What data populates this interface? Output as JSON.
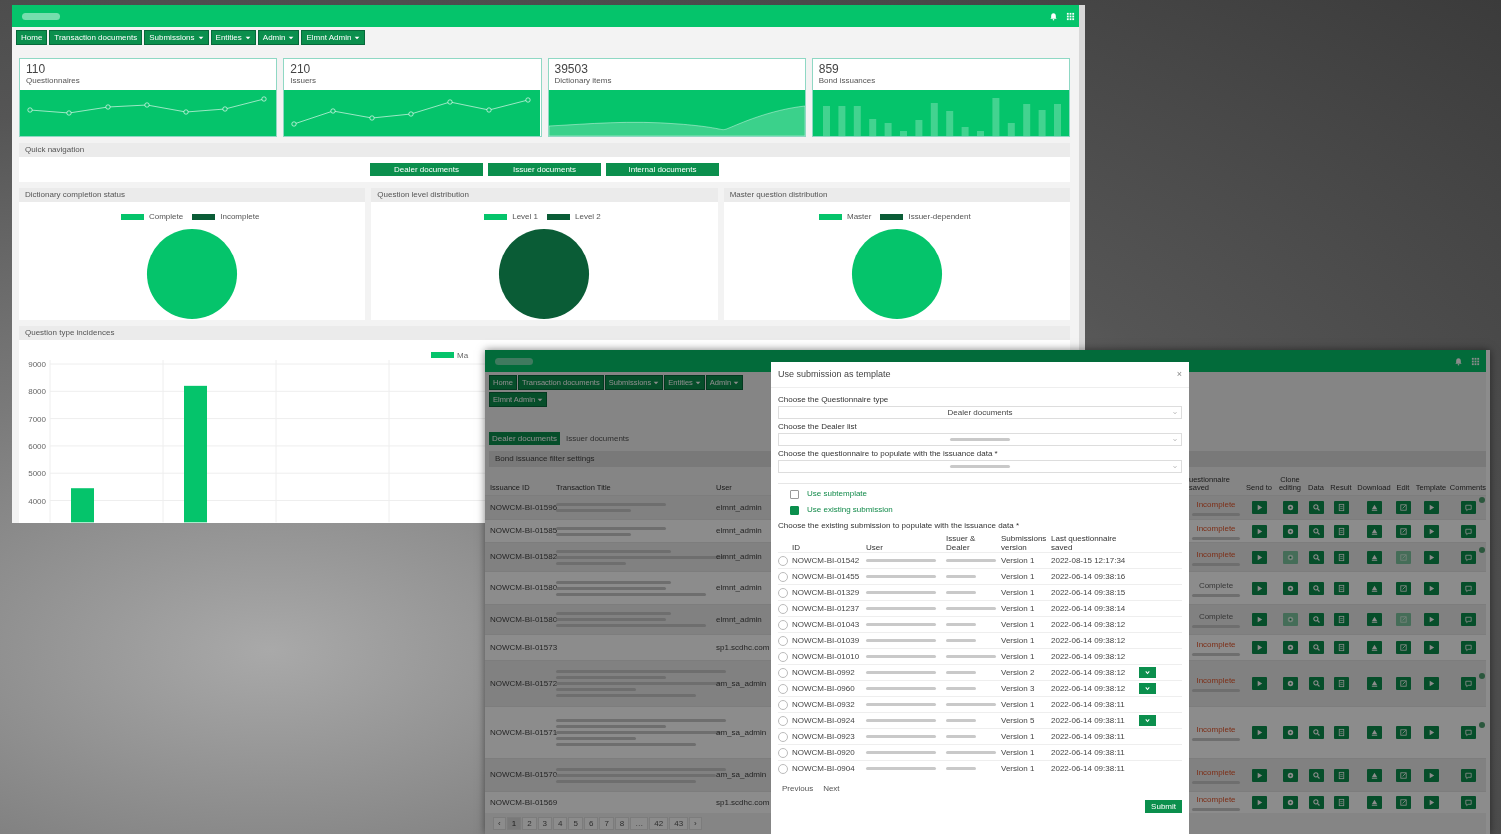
{
  "dashboard": {
    "nav": [
      {
        "label": "Home",
        "dropdown": false
      },
      {
        "label": "Transaction documents",
        "dropdown": false
      },
      {
        "label": "Submissions",
        "dropdown": true
      },
      {
        "label": "Entities",
        "dropdown": true
      },
      {
        "label": "Admin",
        "dropdown": true
      },
      {
        "label": "Elmnt Admin",
        "dropdown": true
      }
    ],
    "stats": [
      {
        "value": "110",
        "label": "Questionnaires",
        "kind": "line"
      },
      {
        "value": "210",
        "label": "Issuers",
        "kind": "line"
      },
      {
        "value": "39503",
        "label": "Dictionary items",
        "kind": "area"
      },
      {
        "value": "859",
        "label": "Bond issuances",
        "kind": "bar"
      }
    ],
    "quick_navigation": {
      "title": "Quick navigation",
      "buttons": [
        "Dealer documents",
        "Issuer documents",
        "Internal documents"
      ]
    },
    "distributions": [
      {
        "title": "Dictionary completion status",
        "chart_data": {
          "type": "pie",
          "categories": [
            "Complete",
            "Incomplete"
          ],
          "values": [
            100,
            0
          ]
        }
      },
      {
        "title": "Question level distribution",
        "chart_data": {
          "type": "pie",
          "categories": [
            "Level 1",
            "Level 2"
          ],
          "values": [
            0,
            100
          ]
        }
      },
      {
        "title": "Master question distribution",
        "chart_data": {
          "type": "pie",
          "categories": [
            "Master",
            "Issuer-dependent"
          ],
          "values": [
            100,
            0
          ]
        }
      }
    ],
    "incidences": {
      "title": "Question type incidences",
      "chart_data": {
        "type": "bar",
        "series": [
          {
            "name": "Ma",
            "values": [
              4450,
              8200,
              null,
              null,
              null,
              null,
              null,
              null,
              null
            ]
          }
        ],
        "ylim": [
          3200,
          9000
        ],
        "yticks": [
          4000,
          5000,
          6000,
          7000,
          8000,
          9000
        ],
        "grid": true
      }
    }
  },
  "submissions": {
    "nav": [
      {
        "label": "Home",
        "dropdown": false
      },
      {
        "label": "Transaction documents",
        "dropdown": false
      },
      {
        "label": "Submissions",
        "dropdown": true
      },
      {
        "label": "Entities",
        "dropdown": true
      },
      {
        "label": "Admin",
        "dropdown": true
      },
      {
        "label": "Elmnt Admin",
        "dropdown": true
      }
    ],
    "tabs": [
      {
        "label": "Dealer documents",
        "selected": true
      },
      {
        "label": "Issuer documents",
        "selected": false
      }
    ],
    "filter_title": "Bond issuance filter settings",
    "columns_left": [
      "Issuance ID",
      "Transaction Title",
      "User"
    ],
    "columns_right": [
      "uestionnaire saved",
      "Send to",
      "Clone editing",
      "Data",
      "Result",
      "Download",
      "Edit",
      "Template",
      "Comments"
    ],
    "rows": [
      {
        "issuance_id": "NOWCM-BI-01596",
        "user": "elmnt_admin",
        "status": "Incomplete",
        "complete": false,
        "clone_disabled": false,
        "edit_disabled": false,
        "has_comment": true
      },
      {
        "issuance_id": "NOWCM-BI-01585",
        "user": "elmnt_admin",
        "status": "Incomplete",
        "complete": false,
        "clone_disabled": false,
        "edit_disabled": false,
        "has_comment": false
      },
      {
        "issuance_id": "NOWCM-BI-01582",
        "user": "elmnt_admin",
        "status": "Incomplete",
        "complete": false,
        "clone_disabled": true,
        "edit_disabled": true,
        "has_comment": true
      },
      {
        "issuance_id": "NOWCM-BI-01580",
        "user": "elmnt_admin",
        "status": "Complete",
        "complete": true,
        "clone_disabled": false,
        "edit_disabled": false,
        "has_comment": false
      },
      {
        "issuance_id": "NOWCM-BI-01580",
        "user": "elmnt_admin",
        "status": "Complete",
        "complete": true,
        "clone_disabled": true,
        "edit_disabled": true,
        "has_comment": false
      },
      {
        "issuance_id": "NOWCM-BI-01573",
        "user": "sp1.scdhc.com",
        "status": "Incomplete",
        "complete": false,
        "clone_disabled": false,
        "edit_disabled": false,
        "has_comment": false
      },
      {
        "issuance_id": "NOWCM-BI-01572",
        "user": "am_sa_admin",
        "status": "Incomplete",
        "complete": false,
        "clone_disabled": false,
        "edit_disabled": false,
        "has_comment": true
      },
      {
        "issuance_id": "NOWCM-BI-01571",
        "user": "am_sa_admin",
        "status": "Incomplete",
        "complete": false,
        "clone_disabled": false,
        "edit_disabled": false,
        "has_comment": true
      },
      {
        "issuance_id": "NOWCM-BI-01570",
        "user": "am_sa_admin",
        "status": "Incomplete",
        "complete": false,
        "clone_disabled": false,
        "edit_disabled": false,
        "has_comment": false
      },
      {
        "issuance_id": "NOWCM-BI-01569",
        "user": "sp1.scdhc.com",
        "status": "Incomplete",
        "complete": false,
        "clone_disabled": false,
        "edit_disabled": false,
        "has_comment": false
      }
    ],
    "pagination": [
      {
        "label": "‹",
        "selected": false
      },
      {
        "label": "1",
        "selected": true
      },
      {
        "label": "2",
        "selected": false
      },
      {
        "label": "3",
        "selected": false
      },
      {
        "label": "4",
        "selected": false
      },
      {
        "label": "5",
        "selected": false
      },
      {
        "label": "6",
        "selected": false
      },
      {
        "label": "7",
        "selected": false
      },
      {
        "label": "8",
        "selected": false
      },
      {
        "label": "…",
        "selected": false
      },
      {
        "label": "42",
        "selected": false
      },
      {
        "label": "43",
        "selected": false
      },
      {
        "label": "›",
        "selected": false
      }
    ],
    "modal": {
      "title": "Use submission as template",
      "close": "×",
      "fields": [
        {
          "label": "Choose the Questionnaire type",
          "value": "Dealer documents",
          "blurred": false
        },
        {
          "label": "Choose the Dealer list",
          "blurred": true
        },
        {
          "label": "Choose the questionnaire to populate with the issuance data *",
          "blurred": true
        }
      ],
      "checkboxes": [
        {
          "label": "Use subtemplate",
          "checked": false
        },
        {
          "label": "Use existing submission",
          "checked": true
        }
      ],
      "table_label": "Choose the existing submission to populate with the issuance data *",
      "columns": [
        "ID",
        "User",
        "Issuer & Dealer",
        "Submissions version",
        "Last questionnaire saved"
      ],
      "rows": [
        {
          "id": "NOWCM-BI-01542",
          "version": "Version 1",
          "saved": "2022-08-15 12:17:34",
          "expand": false,
          "selected": false
        },
        {
          "id": "NOWCM-BI-01455",
          "version": "Version 1",
          "saved": "2022-06-14 09:38:16",
          "expand": false,
          "selected": false
        },
        {
          "id": "NOWCM-BI-01329",
          "version": "Version 1",
          "saved": "2022-06-14 09:38:15",
          "expand": false,
          "selected": false
        },
        {
          "id": "NOWCM-BI-01237",
          "version": "Version 1",
          "saved": "2022-06-14 09:38:14",
          "expand": false,
          "selected": false
        },
        {
          "id": "NOWCM-BI-01043",
          "version": "Version 1",
          "saved": "2022-06-14 09:38:12",
          "expand": false,
          "selected": false
        },
        {
          "id": "NOWCM-BI-01039",
          "version": "Version 1",
          "saved": "2022-06-14 09:38:12",
          "expand": false,
          "selected": false
        },
        {
          "id": "NOWCM-BI-01010",
          "version": "Version 1",
          "saved": "2022-06-14 09:38:12",
          "expand": false,
          "selected": false
        },
        {
          "id": "NOWCM-BI-0992",
          "version": "Version 2",
          "saved": "2022-06-14 09:38:12",
          "expand": true,
          "selected": false
        },
        {
          "id": "NOWCM-BI-0960",
          "version": "Version 3",
          "saved": "2022-06-14 09:38:12",
          "expand": true,
          "selected": false
        },
        {
          "id": "NOWCM-BI-0932",
          "version": "Version 1",
          "saved": "2022-06-14 09:38:11",
          "expand": false,
          "selected": false
        },
        {
          "id": "NOWCM-BI-0924",
          "version": "Version 5",
          "saved": "2022-06-14 09:38:11",
          "expand": true,
          "selected": false
        },
        {
          "id": "NOWCM-BI-0923",
          "version": "Version 1",
          "saved": "2022-06-14 09:38:11",
          "expand": false,
          "selected": false
        },
        {
          "id": "NOWCM-BI-0920",
          "version": "Version 1",
          "saved": "2022-06-14 09:38:11",
          "expand": false,
          "selected": false
        },
        {
          "id": "NOWCM-BI-0904",
          "version": "Version 1",
          "saved": "2022-06-14 09:38:11",
          "expand": false,
          "selected": false
        }
      ],
      "pager": [
        "Previous",
        "Next"
      ],
      "submit": "Submit"
    }
  }
}
